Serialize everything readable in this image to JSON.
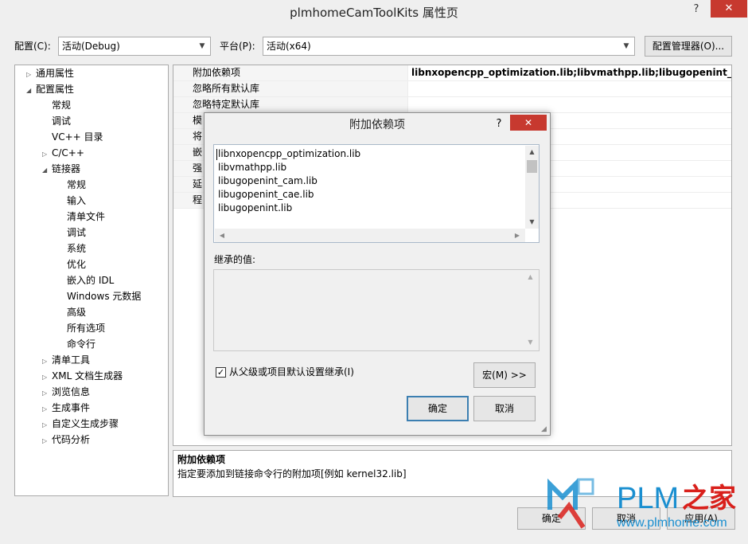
{
  "window": {
    "title": "plmhomeCamToolKits 属性页",
    "help": "?",
    "close": "✕"
  },
  "config": {
    "label": "配置(C):",
    "value": "活动(Debug)"
  },
  "platform": {
    "label": "平台(P):",
    "value": "活动(x64)"
  },
  "config_manager_button": "配置管理器(O)...",
  "tree": [
    {
      "label": "通用属性",
      "level": 0,
      "expander": "▷"
    },
    {
      "label": "配置属性",
      "level": 0,
      "expander": "◢"
    },
    {
      "label": "常规",
      "level": 1,
      "expander": ""
    },
    {
      "label": "调试",
      "level": 1,
      "expander": ""
    },
    {
      "label": "VC++ 目录",
      "level": 1,
      "expander": ""
    },
    {
      "label": "C/C++",
      "level": 1,
      "expander": "▷"
    },
    {
      "label": "链接器",
      "level": 1,
      "expander": "◢"
    },
    {
      "label": "常规",
      "level": 2,
      "expander": ""
    },
    {
      "label": "输入",
      "level": 2,
      "expander": ""
    },
    {
      "label": "清单文件",
      "level": 2,
      "expander": ""
    },
    {
      "label": "调试",
      "level": 2,
      "expander": ""
    },
    {
      "label": "系统",
      "level": 2,
      "expander": ""
    },
    {
      "label": "优化",
      "level": 2,
      "expander": ""
    },
    {
      "label": "嵌入的 IDL",
      "level": 2,
      "expander": ""
    },
    {
      "label": "Windows 元数据",
      "level": 2,
      "expander": ""
    },
    {
      "label": "高级",
      "level": 2,
      "expander": ""
    },
    {
      "label": "所有选项",
      "level": 2,
      "expander": ""
    },
    {
      "label": "命令行",
      "level": 2,
      "expander": ""
    },
    {
      "label": "清单工具",
      "level": 1,
      "expander": "▷"
    },
    {
      "label": "XML 文档生成器",
      "level": 1,
      "expander": "▷"
    },
    {
      "label": "浏览信息",
      "level": 1,
      "expander": "▷"
    },
    {
      "label": "生成事件",
      "level": 1,
      "expander": "▷"
    },
    {
      "label": "自定义生成步骤",
      "level": 1,
      "expander": "▷"
    },
    {
      "label": "代码分析",
      "level": 1,
      "expander": "▷"
    }
  ],
  "grid": [
    {
      "name": "附加依赖项",
      "value": "libnxopencpp_optimization.lib;libvmathpp.lib;libugopenint_cam.lib;libugopenint_cae.lib;libugopenint.lib;%(AdditionalDependencies)"
    },
    {
      "name": "忽略所有默认库",
      "value": ""
    },
    {
      "name": "忽略特定默认库",
      "value": ""
    },
    {
      "name": "模",
      "value": ""
    },
    {
      "name": "将",
      "value": ""
    },
    {
      "name": "嵌",
      "value": ""
    },
    {
      "name": "强",
      "value": ""
    },
    {
      "name": "延",
      "value": ""
    },
    {
      "name": "程",
      "value": ""
    }
  ],
  "description": {
    "title": "附加依赖项",
    "text": "指定要添加到链接命令行的附加项[例如 kernel32.lib]"
  },
  "bottom_buttons": {
    "ok": "确定",
    "cancel": "取消",
    "apply": "应用(A)"
  },
  "dialog": {
    "title": "附加依赖项",
    "help": "?",
    "close": "✕",
    "items": [
      "libnxopencpp_optimization.lib",
      "libvmathpp.lib",
      "libugopenint_cam.lib",
      "libugopenint_cae.lib",
      "libugopenint.lib"
    ],
    "inherited_label": "继承的值:",
    "inherit_checkbox": {
      "label": "从父级或项目默认设置继承(I)",
      "checked": true
    },
    "macro_button": "宏(M) >>",
    "ok": "确定",
    "cancel": "取消"
  },
  "watermark": {
    "brand": "PLM",
    "brand_cn": "之家",
    "url": "www.plmhome.com"
  },
  "colors": {
    "close_red": "#c7392f",
    "watermark_blue": "#1a8fd0",
    "watermark_red": "#d9201b",
    "focus_blue": "#3c7fb1"
  }
}
